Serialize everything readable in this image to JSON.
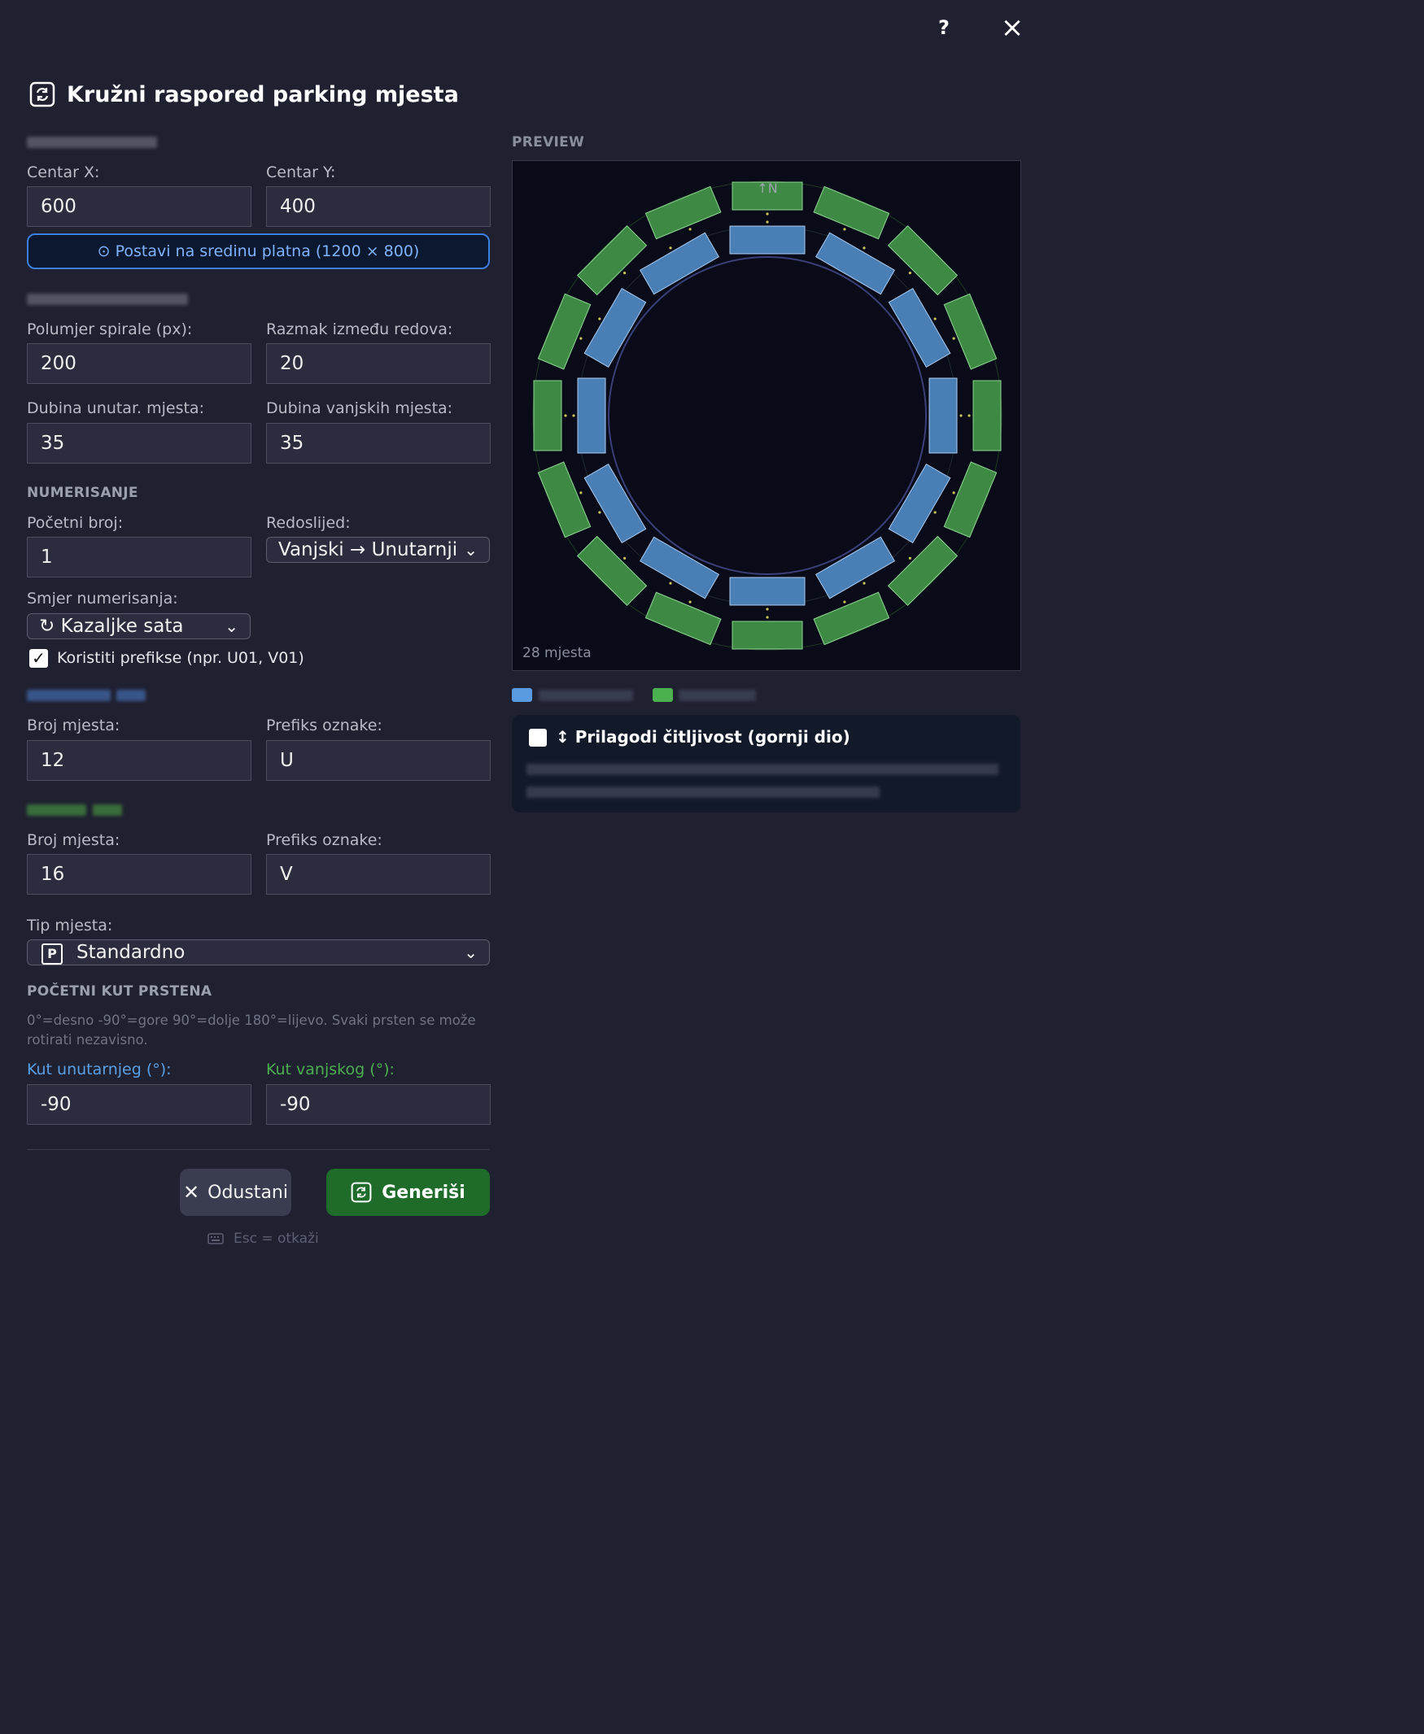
{
  "topbar": {
    "help_label": "?",
    "close_label": "×"
  },
  "dialog": {
    "title": "Kružni raspored parking mjesta",
    "title_icon": "ring-layout-icon"
  },
  "center": {
    "x_label": "Centar X:",
    "x_value": "600",
    "y_label": "Centar Y:",
    "y_value": "400",
    "center_button": "⊙  Postavi na sredinu platna (1200 × 800)"
  },
  "geometry": {
    "radius_label": "Polumjer spirale (px):",
    "radius_value": "200",
    "gap_label": "Razmak između redova:",
    "gap_value": "20",
    "inner_depth_label": "Dubina unutar. mjesta:",
    "inner_depth_value": "35",
    "outer_depth_label": "Dubina vanjskih mjesta:",
    "outer_depth_value": "35"
  },
  "numbering": {
    "section": "NUMERISANJE",
    "start_label": "Početni broj:",
    "start_value": "1",
    "order_label": "Redoslijed:",
    "order_value": "Vanjski → Unutarnji",
    "direction_label": "Smjer numerisanja:",
    "direction_value": "↻ Kazaljke sata",
    "prefix_checkbox_label": "Koristiti prefikse (npr. U01, V01)",
    "prefix_checked": true
  },
  "inner_ring": {
    "count_label": "Broj mjesta:",
    "count_value": "12",
    "prefix_label": "Prefiks oznake:",
    "prefix_value": "U"
  },
  "outer_ring": {
    "count_label": "Broj mjesta:",
    "count_value": "16",
    "prefix_label": "Prefiks oznake:",
    "prefix_value": "V"
  },
  "type": {
    "label": "Tip mjesta:",
    "value": "Standardno",
    "icon": "parking-p-icon"
  },
  "start_angle": {
    "section": "POČETNI KUT PRSTENA",
    "hint": "0°=desno  -90°=gore  90°=dolje  180°=lijevo. Svaki prsten se može rotirati nezavisno.",
    "inner_label": "Kut unutarnjeg (°):",
    "inner_value": "-90",
    "outer_label": "Kut vanjskog (°):",
    "outer_value": "-90"
  },
  "preview": {
    "section": "PREVIEW",
    "count_text": "28 mjesta",
    "north_label": "↑N",
    "inner_count": 12,
    "outer_count": 16,
    "inner_color": "#4a7fb5",
    "outer_color": "#3e8a45"
  },
  "readability": {
    "label": "↕ Prilagodi čitljivost (gornji dio)",
    "checked": false
  },
  "actions": {
    "cancel": "Odustani",
    "generate": "Generiši",
    "shortcut_hint": "Esc = otkaži"
  },
  "colors": {
    "accent_blue": "#3b7fe0",
    "inner_label_color": "#5aa0e6",
    "outer_label_color": "#4caf50"
  }
}
